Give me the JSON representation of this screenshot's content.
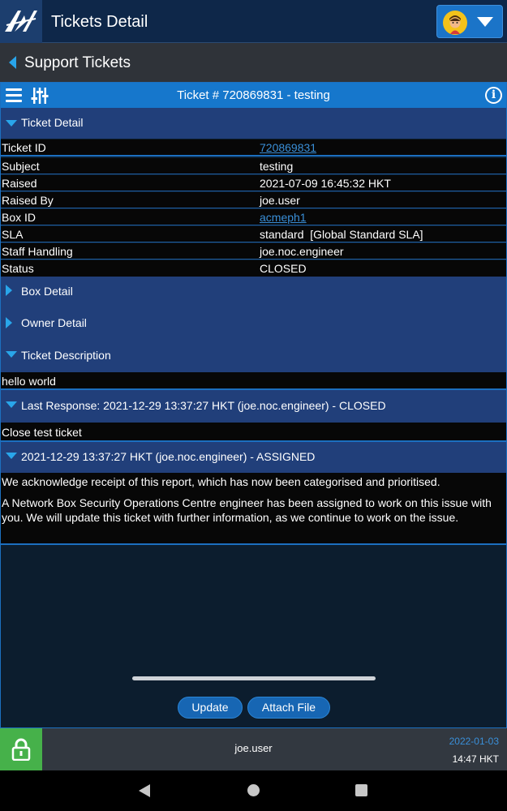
{
  "app": {
    "title": "Tickets Detail",
    "accent": "#1677cc",
    "user_icon": "person-avatar-icon"
  },
  "nav": {
    "back_label": "Support Tickets"
  },
  "ticket": {
    "header": "Ticket # 720869831 - testing",
    "detail_section": "Ticket Detail",
    "fields": [
      {
        "key": "Ticket ID",
        "value": "720869831",
        "link": true
      },
      {
        "key": "Subject",
        "value": "testing",
        "link": false
      },
      {
        "key": "Raised",
        "value": "2021-07-09 16:45:32 HKT",
        "link": false
      },
      {
        "key": "Raised By",
        "value": "joe.user",
        "link": false
      },
      {
        "key": "Box ID",
        "value": "acmeph1",
        "link": true
      },
      {
        "key": "SLA",
        "value": "standard  [Global Standard SLA]",
        "link": false
      },
      {
        "key": "Staff Handling",
        "value": "joe.noc.engineer",
        "link": false
      },
      {
        "key": "Status",
        "value": "CLOSED",
        "link": false
      }
    ],
    "box_detail_section": "Box Detail",
    "owner_detail_section": "Owner Detail",
    "description_section": "Ticket Description",
    "description": "hello world",
    "last_response_section": "Last Response: 2021-12-29 13:37:27 HKT (joe.noc.engineer) - CLOSED",
    "last_response_text": "Close test ticket",
    "assigned_section": "2021-12-29 13:37:27 HKT (joe.noc.engineer) - ASSIGNED",
    "assigned_para1": "We acknowledge receipt of this report, which has now been categorised and prioritised.",
    "assigned_para2": "A Network Box Security Operations Centre engineer has been assigned to work on this issue with you. We will update this ticket with further information, as we continue to work on the issue."
  },
  "actions": {
    "update_label": "Update",
    "attach_label": "Attach File"
  },
  "status": {
    "user": "joe.user",
    "date": "2022-01-03",
    "time": "14:47 HKT",
    "lock_color": "#46b14a"
  }
}
